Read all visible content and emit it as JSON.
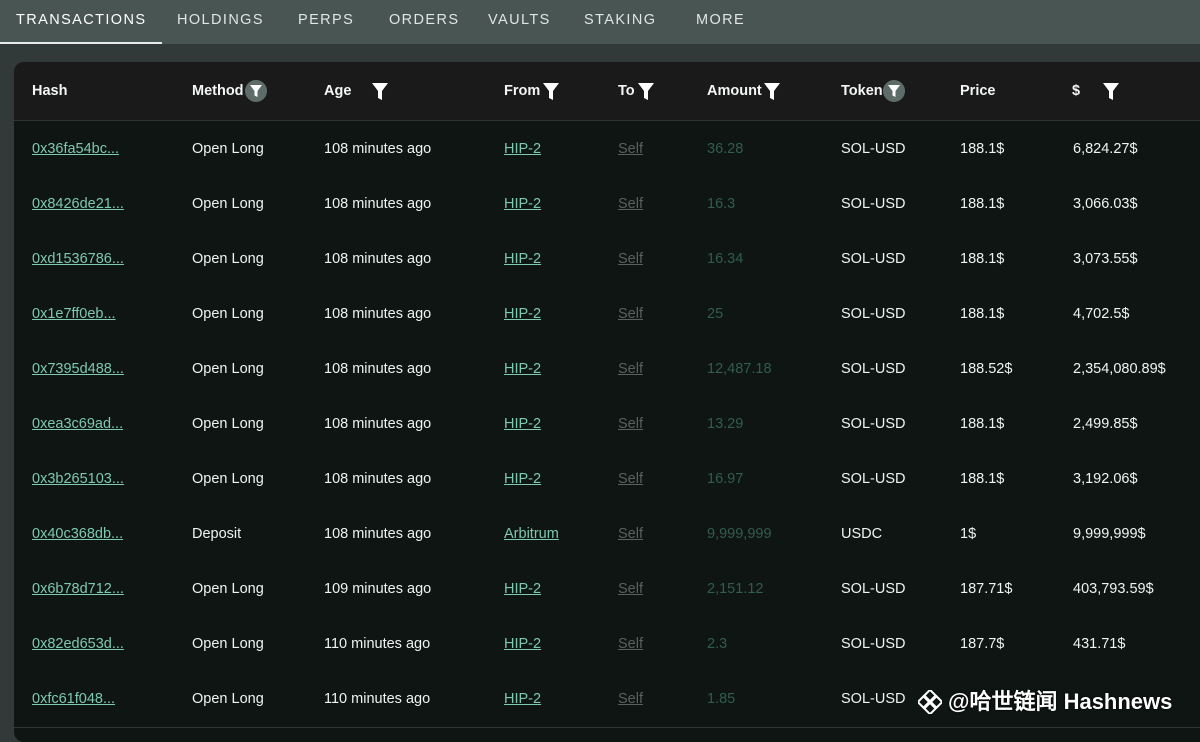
{
  "tabs": [
    {
      "label": "TRANSACTIONS",
      "active": true
    },
    {
      "label": "HOLDINGS"
    },
    {
      "label": "PERPS"
    },
    {
      "label": "ORDERS"
    },
    {
      "label": "VAULTS"
    },
    {
      "label": "STAKING"
    },
    {
      "label": "MORE"
    }
  ],
  "columns": {
    "hash": "Hash",
    "method": "Method",
    "age": "Age",
    "from": "From",
    "to": "To",
    "amount": "Amount",
    "token": "Token",
    "price": "Price",
    "usd": "$"
  },
  "rows": [
    {
      "hash": "0x36fa54bc...",
      "method": "Open Long",
      "age": "108 minutes ago",
      "from": "HIP-2",
      "to": "Self",
      "amount": "36.28",
      "token": "SOL-USD",
      "price": "188.1$",
      "usd": "6,824.27$"
    },
    {
      "hash": "0x8426de21...",
      "method": "Open Long",
      "age": "108 minutes ago",
      "from": "HIP-2",
      "to": "Self",
      "amount": "16.3",
      "token": "SOL-USD",
      "price": "188.1$",
      "usd": "3,066.03$"
    },
    {
      "hash": "0xd1536786...",
      "method": "Open Long",
      "age": "108 minutes ago",
      "from": "HIP-2",
      "to": "Self",
      "amount": "16.34",
      "token": "SOL-USD",
      "price": "188.1$",
      "usd": "3,073.55$"
    },
    {
      "hash": "0x1e7ff0eb...",
      "method": "Open Long",
      "age": "108 minutes ago",
      "from": "HIP-2",
      "to": "Self",
      "amount": "25",
      "token": "SOL-USD",
      "price": "188.1$",
      "usd": "4,702.5$"
    },
    {
      "hash": "0x7395d488...",
      "method": "Open Long",
      "age": "108 minutes ago",
      "from": "HIP-2",
      "to": "Self",
      "amount": "12,487.18",
      "token": "SOL-USD",
      "price": "188.52$",
      "usd": "2,354,080.89$"
    },
    {
      "hash": "0xea3c69ad...",
      "method": "Open Long",
      "age": "108 minutes ago",
      "from": "HIP-2",
      "to": "Self",
      "amount": "13.29",
      "token": "SOL-USD",
      "price": "188.1$",
      "usd": "2,499.85$"
    },
    {
      "hash": "0x3b265103...",
      "method": "Open Long",
      "age": "108 minutes ago",
      "from": "HIP-2",
      "to": "Self",
      "amount": "16.97",
      "token": "SOL-USD",
      "price": "188.1$",
      "usd": "3,192.06$"
    },
    {
      "hash": "0x40c368db...",
      "method": "Deposit",
      "age": "108 minutes ago",
      "from": "Arbitrum",
      "to": "Self",
      "amount": "9,999,999",
      "token": "USDC",
      "price": "1$",
      "usd": "9,999,999$"
    },
    {
      "hash": "0x6b78d712...",
      "method": "Open Long",
      "age": "109 minutes ago",
      "from": "HIP-2",
      "to": "Self",
      "amount": "2,151.12",
      "token": "SOL-USD",
      "price": "187.71$",
      "usd": "403,793.59$"
    },
    {
      "hash": "0x82ed653d...",
      "method": "Open Long",
      "age": "110 minutes ago",
      "from": "HIP-2",
      "to": "Self",
      "amount": "2.3",
      "token": "SOL-USD",
      "price": "187.7$",
      "usd": "431.71$"
    },
    {
      "hash": "0xfc61f048...",
      "method": "Open Long",
      "age": "110 minutes ago",
      "from": "HIP-2",
      "to": "Self",
      "amount": "1.85",
      "token": "SOL-USD",
      "price": "",
      "usd": ""
    }
  ],
  "watermark": {
    "text": "@哈世链闻 Hashnews"
  },
  "colors": {
    "link": "#7fc9b0",
    "self": "#57625f",
    "amount": "#325c4f",
    "panel": "#0e1513",
    "tabbar": "#485552"
  },
  "icons": {
    "filter": "filter-icon",
    "watermark_logo": "binance-diamond-icon"
  }
}
